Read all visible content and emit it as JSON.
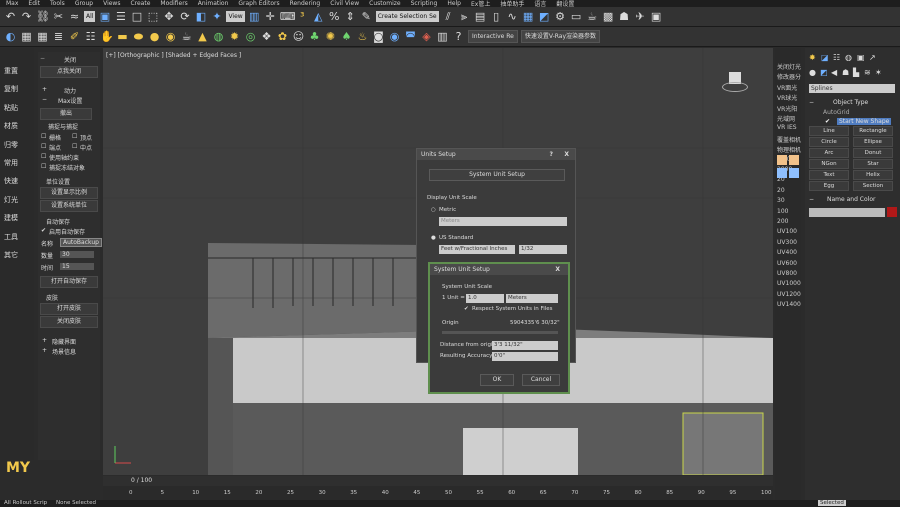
{
  "window": {
    "title": ""
  },
  "menu": [
    "Max",
    "Edit",
    "Tools",
    "Group",
    "Views",
    "Create",
    "Modifiers",
    "Animation",
    "Graph Editors",
    "Rendering",
    "Civil View",
    "Customize",
    "Scripting",
    "Help",
    "Ex管上",
    "抽单助手",
    "语言",
    "翻设置"
  ],
  "toolbar1": {
    "selection_filter": "All",
    "ref_coord": "View",
    "named_sel": "Create Selection Se"
  },
  "toolbar2": {
    "interactive_label": "Interactive Re",
    "vray_label": "快速设置V-Ray渲染器参数"
  },
  "left_column": [
    "重置",
    "复制",
    "粘贴",
    "材质",
    "归零",
    "常用",
    "快速",
    "灯光",
    "建模",
    "工具",
    "其它"
  ],
  "left_panel": {
    "close_label": "关闭",
    "open_close_label": "点我关闭",
    "power": "动力",
    "max_settings": "Max设置",
    "exit_label": "撤出",
    "snap_cap": "捕捉与捕捉",
    "grid": "栅格",
    "vertex": "顶点",
    "endpoint": "端点",
    "midpoint": "中点",
    "use_axis": "使用轴约束",
    "snap_frozen": "捕捉冻结对象",
    "unit_settings": "单位设置",
    "set_scale": "设置显示比例",
    "set_system_unit": "设置系统单位",
    "autosave": "自动保存",
    "enable_autosave": "启用自动保存",
    "name_label": "名称",
    "name_value": "AutoBackup",
    "count_label": "数量",
    "count_value": "30",
    "time_label": "时间",
    "time_value": "15",
    "open_autosave": "打开自动保存",
    "skin": "皮肤",
    "open_skin": "打开皮肤",
    "close_skin": "关闭皮肤",
    "hide_ui": "隐藏界面",
    "scene_info": "场景信息"
  },
  "viewport": {
    "label": "[+] [Orthographic ] [Shaded + Edged Faces ]"
  },
  "right_column": [
    "关闭灯光",
    "修改器分",
    "VR面光",
    "VR球光",
    "VR光阳",
    "光域网",
    "VR IES",
    "覆盖相机",
    "物理相机",
    "-100",
    "2800",
    "20",
    "20",
    "30",
    "100",
    "200",
    "UV100",
    "UV300",
    "UV400",
    "UV600",
    "UV800",
    "UV1000",
    "UV1200",
    "UV1400"
  ],
  "command_panel": {
    "category": "Splines",
    "object_type": "Object Type",
    "autogrid": "AutoGrid",
    "start_new_shape": "Start New Shape",
    "buttons": [
      "Line",
      "Rectangle",
      "Circle",
      "Ellipse",
      "Arc",
      "Donut",
      "NGon",
      "Star",
      "Text",
      "Helix",
      "Egg",
      "Section"
    ],
    "name_and_color": "Name and Color"
  },
  "units_dialog": {
    "title": "Units Setup",
    "system_unit_setup": "System Unit Setup",
    "display_unit_scale": "Display Unit Scale",
    "metric": "Metric",
    "metric_value": "Meters",
    "us_standard": "US Standard",
    "us_value": "Feet w/Fractional Inches",
    "fraction": "1/32",
    "help_btn": "?",
    "close_btn": "X"
  },
  "system_dialog": {
    "title": "System Unit Setup",
    "section": "System Unit Scale",
    "unit_label": "1 Unit =",
    "unit_value": "1.0",
    "unit_type": "Meters",
    "respect_units": "Respect System Units in Files",
    "origin_label": "Origin",
    "origin_value": "5904335'6 30/32\"",
    "distance_label": "Distance from origin:",
    "distance_value": "3'3 11/32\"",
    "accuracy_label": "Resulting Accuracy:",
    "accuracy_value": "0'0\"",
    "ok": "OK",
    "cancel": "Cancel",
    "close_btn": "X"
  },
  "timeline": {
    "frame": "0 / 100",
    "ticks": [
      "0",
      "5",
      "10",
      "15",
      "20",
      "25",
      "30",
      "35",
      "40",
      "45",
      "50",
      "55",
      "60",
      "65",
      "70",
      "75",
      "80",
      "85",
      "90",
      "95",
      "100"
    ]
  },
  "statusbar": {
    "left": "All Rollout Scrip",
    "status": "None Selected",
    "selected": "Selected"
  },
  "logo": "MY",
  "colors": {
    "accent": "#4f9ae0",
    "dialog_highlight": "#5f8f4e"
  }
}
